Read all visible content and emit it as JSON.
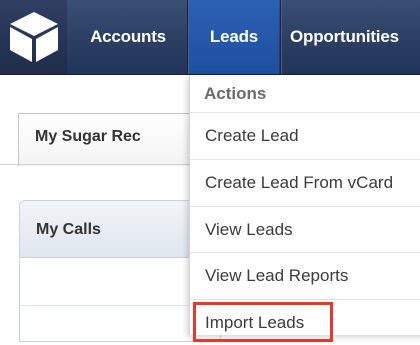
{
  "nav": {
    "logo_icon": "cube-logo-icon",
    "tabs": [
      {
        "label": "Accounts"
      },
      {
        "label": "Leads"
      },
      {
        "label": "Opportunities"
      }
    ],
    "active_tab": "Leads",
    "colors": {
      "bar": "#2d4064",
      "active": "#2457a8"
    }
  },
  "dashboard": {
    "tab_label": "My Sugar Rec",
    "calls_title": "My Calls"
  },
  "leads_menu": {
    "header": "Actions",
    "items": [
      {
        "label": "Create Lead"
      },
      {
        "label": "Create Lead From vCard"
      },
      {
        "label": "View Leads"
      },
      {
        "label": "View Lead Reports"
      },
      {
        "label": "Import Leads"
      }
    ],
    "highlighted_item": "Import Leads",
    "highlight_color": "#e8382c"
  }
}
